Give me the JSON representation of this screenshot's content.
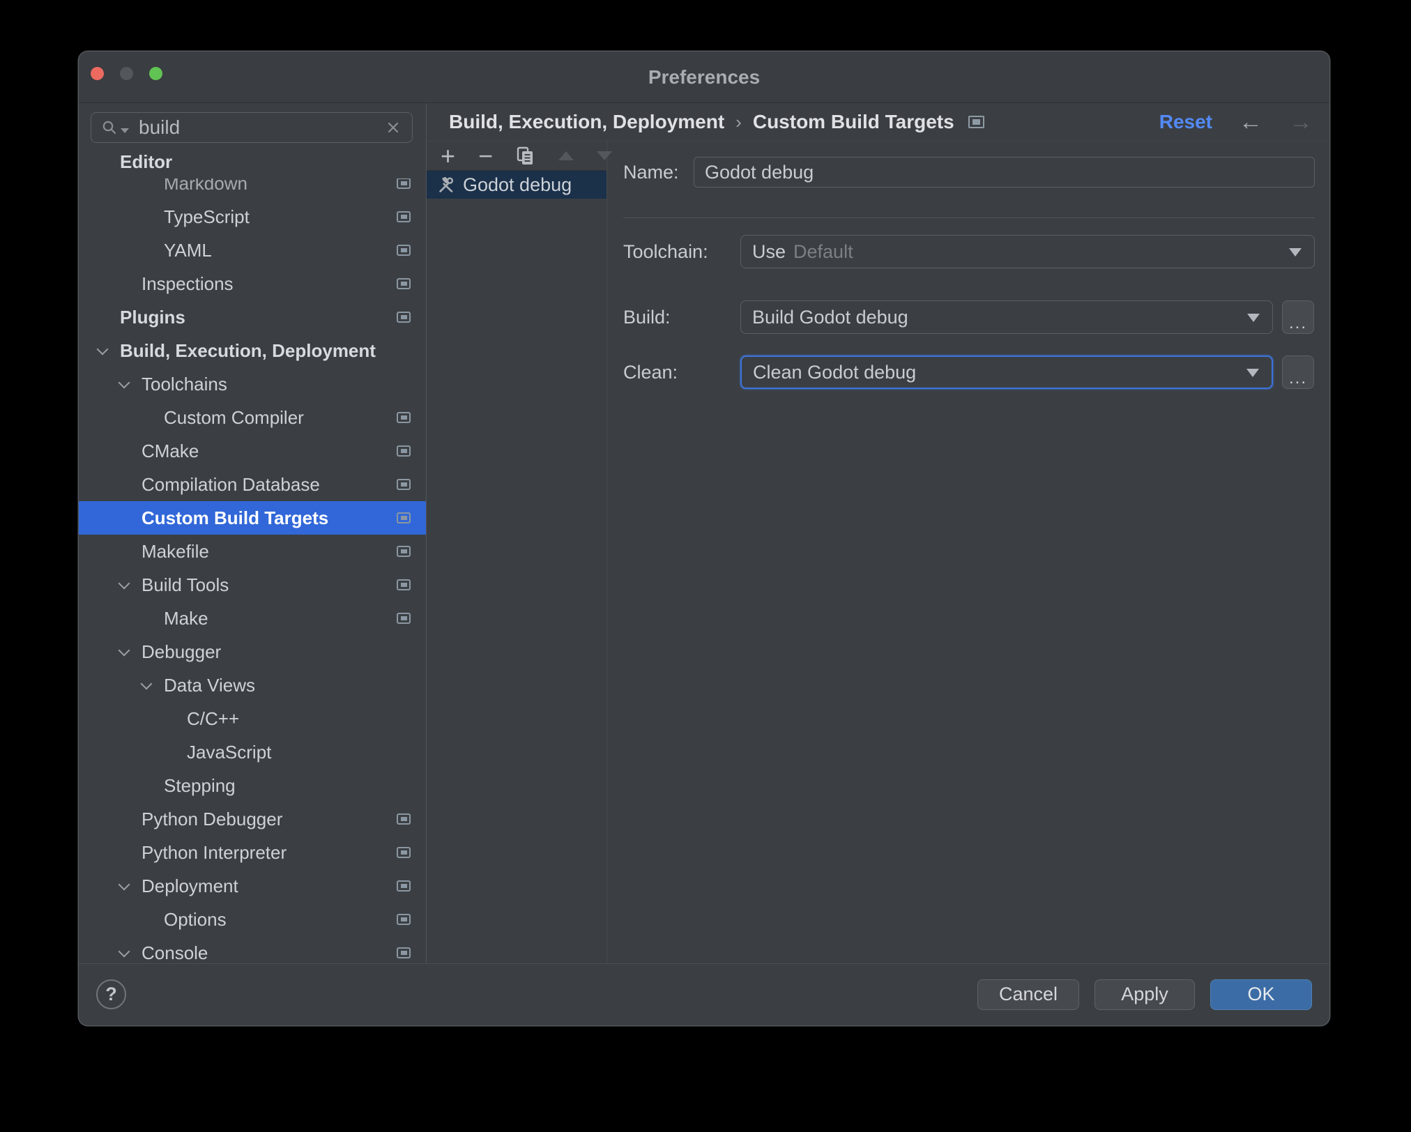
{
  "window": {
    "title": "Preferences"
  },
  "colors": {
    "selection_blue": "#3167d8",
    "list_selection_navy": "#1b3049",
    "accent_link_blue": "#548af7",
    "ok_button_blue": "#3c6ca5",
    "focus_ring_blue": "#3d74dc",
    "traffic_close": "#ec6a5f",
    "traffic_minimize_disabled": "#53575b",
    "traffic_zoom": "#61c354"
  },
  "sidebar": {
    "search": {
      "value": "build",
      "icons": [
        "search-icon",
        "search-options-chevron-icon",
        "clear-icon"
      ]
    },
    "tree": [
      {
        "label": "Editor",
        "indent": 0,
        "bold": true,
        "sticky": true
      },
      {
        "label": "Markdown",
        "indent": 2,
        "icon": true,
        "overlap": true
      },
      {
        "label": "TypeScript",
        "indent": 2,
        "icon": true
      },
      {
        "label": "YAML",
        "indent": 2,
        "icon": true
      },
      {
        "label": "Inspections",
        "indent": 1,
        "icon": true
      },
      {
        "label": "Plugins",
        "indent": 0,
        "bold": true,
        "icon": true
      },
      {
        "label": "Build, Execution, Deployment",
        "indent": 0,
        "bold": true,
        "chevron": true
      },
      {
        "label": "Toolchains",
        "indent": 1,
        "chevron": true
      },
      {
        "label": "Custom Compiler",
        "indent": 2,
        "icon": true
      },
      {
        "label": "CMake",
        "indent": 1,
        "icon": true
      },
      {
        "label": "Compilation Database",
        "indent": 1,
        "icon": true
      },
      {
        "label": "Custom Build Targets",
        "indent": 1,
        "icon": true,
        "selected": true
      },
      {
        "label": "Makefile",
        "indent": 1,
        "icon": true
      },
      {
        "label": "Build Tools",
        "indent": 1,
        "chevron": true,
        "icon": true
      },
      {
        "label": "Make",
        "indent": 2,
        "icon": true
      },
      {
        "label": "Debugger",
        "indent": 1,
        "chevron": true
      },
      {
        "label": "Data Views",
        "indent": 2,
        "chevron": true
      },
      {
        "label": "C/C++",
        "indent": 3
      },
      {
        "label": "JavaScript",
        "indent": 3
      },
      {
        "label": "Stepping",
        "indent": 2
      },
      {
        "label": "Python Debugger",
        "indent": 1,
        "icon": true
      },
      {
        "label": "Python Interpreter",
        "indent": 1,
        "icon": true
      },
      {
        "label": "Deployment",
        "indent": 1,
        "chevron": true,
        "icon": true
      },
      {
        "label": "Options",
        "indent": 2,
        "icon": true
      },
      {
        "label": "Console",
        "indent": 1,
        "chevron": true,
        "icon": true
      }
    ]
  },
  "header": {
    "breadcrumb": [
      "Build, Execution, Deployment",
      "Custom Build Targets"
    ],
    "separator": "›",
    "reset_label": "Reset",
    "back_arrow": "←",
    "forward_arrow": "→"
  },
  "list": {
    "toolbar_icons": [
      "add-icon",
      "remove-icon",
      "copy-icon",
      "move-up-icon",
      "move-down-icon"
    ],
    "toolbar_add": "+",
    "toolbar_remove": "−",
    "items": [
      {
        "label": "Godot debug",
        "icon": "build-tools-icon",
        "selected": true
      }
    ]
  },
  "form": {
    "name_label": "Name:",
    "name_value": "Godot debug",
    "toolchain_label": "Toolchain:",
    "toolchain_prefix": "Use",
    "toolchain_value": "Default",
    "build_label": "Build:",
    "build_value": "Build Godot debug",
    "clean_label": "Clean:",
    "clean_value": "Clean Godot debug",
    "more_label": "..."
  },
  "footer": {
    "help_label": "?",
    "cancel_label": "Cancel",
    "apply_label": "Apply",
    "ok_label": "OK"
  }
}
